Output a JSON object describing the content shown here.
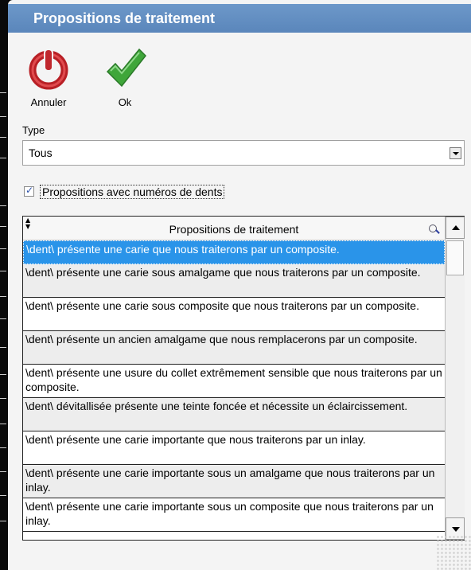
{
  "dialog": {
    "title": "Propositions de traitement"
  },
  "toolbar": {
    "cancel_label": "Annuler",
    "ok_label": "Ok",
    "cancel_icon": "power-icon",
    "ok_icon": "checkmark-icon",
    "cancel_color": "#c0272d",
    "ok_color": "#3fa63a"
  },
  "type": {
    "label": "Type",
    "value": "Tous"
  },
  "checkbox": {
    "label": "Propositions avec numéros de dents",
    "checked": true
  },
  "grid": {
    "header": "Propositions de traitement",
    "selected_color": "#2a94e9",
    "rows": [
      "\\dent\\ présente une carie que nous traiterons par un composite.",
      "\\dent\\ présente une carie sous amalgame que nous traiterons par un composite.",
      "\\dent\\ présente une carie sous composite que nous traiterons par un composite.",
      "\\dent\\ présente un ancien amalgame que nous remplacerons par un composite.",
      "\\dent\\ présente une usure du collet extrêmement sensible que nous traiterons par un composite.",
      "\\dent\\ dévitallisée présente une teinte foncée et nécessite un éclaircissement.",
      "\\dent\\ présente une carie importante que nous traiterons par un inlay.",
      "\\dent\\ présente une carie importante sous un amalgame que nous traiterons par un inlay.",
      "\\dent\\ présente une carie importante sous un composite que nous traiterons par un inlay."
    ]
  }
}
